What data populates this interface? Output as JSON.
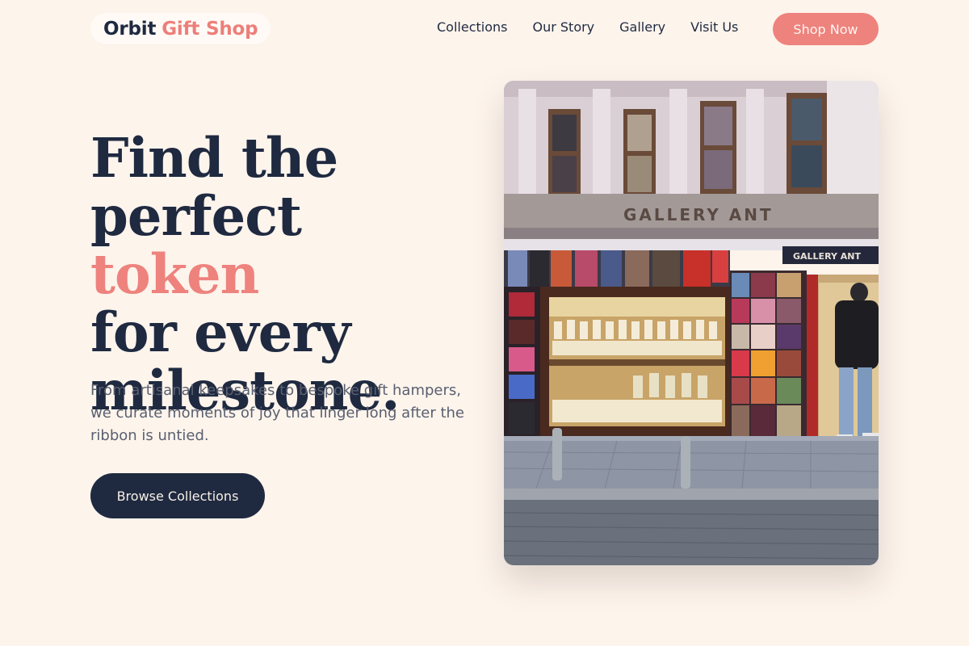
{
  "header": {
    "logo_part1": "Orbit",
    "logo_part2": "Gift Shop",
    "nav": [
      "Collections",
      "Our Story",
      "Gallery",
      "Visit Us"
    ],
    "cta": "Shop Now"
  },
  "hero": {
    "headline_line1": "Find the",
    "headline_line2a": "perfect",
    "headline_accent": "token",
    "headline_line3": "for every",
    "headline_line4": "milestone.",
    "subtext": "From artisanal keepsakes to bespoke gift hampers, we curate moments of joy that linger long after the ribbon is untied.",
    "button": "Browse Collections",
    "photo": {
      "shop_sign": "GALLERY ANT",
      "shop_sign_small": "GALLERY ANT"
    }
  },
  "colors": {
    "background": "#fdf4ec",
    "navy": "#1f2a40",
    "coral": "#ee827d"
  }
}
